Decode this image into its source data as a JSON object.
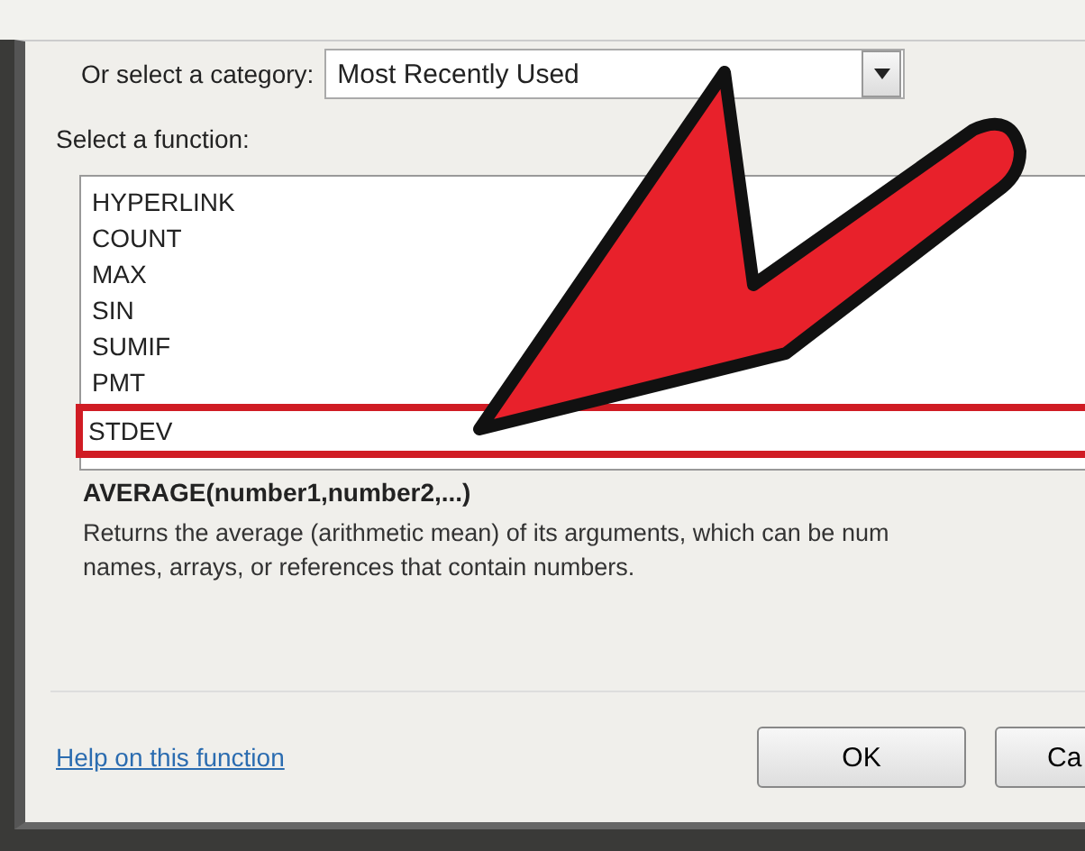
{
  "category": {
    "label": "Or select a category:",
    "value": "Most Recently Used"
  },
  "function_list": {
    "label": "Select a function:",
    "items": [
      {
        "name": "HYPERLINK",
        "highlighted": false
      },
      {
        "name": "COUNT",
        "highlighted": false
      },
      {
        "name": "MAX",
        "highlighted": false
      },
      {
        "name": "SIN",
        "highlighted": false
      },
      {
        "name": "SUMIF",
        "highlighted": false
      },
      {
        "name": "PMT",
        "highlighted": false
      },
      {
        "name": "STDEV",
        "highlighted": true
      }
    ]
  },
  "signature": "AVERAGE(number1,number2,...)",
  "description": [
    "Returns the average (arithmetic mean) of its arguments, which can be num",
    "names, arrays, or references that contain numbers."
  ],
  "help_link": "Help on this function",
  "buttons": [
    "OK",
    "Ca"
  ],
  "annotation": {
    "kind": "arrow"
  }
}
